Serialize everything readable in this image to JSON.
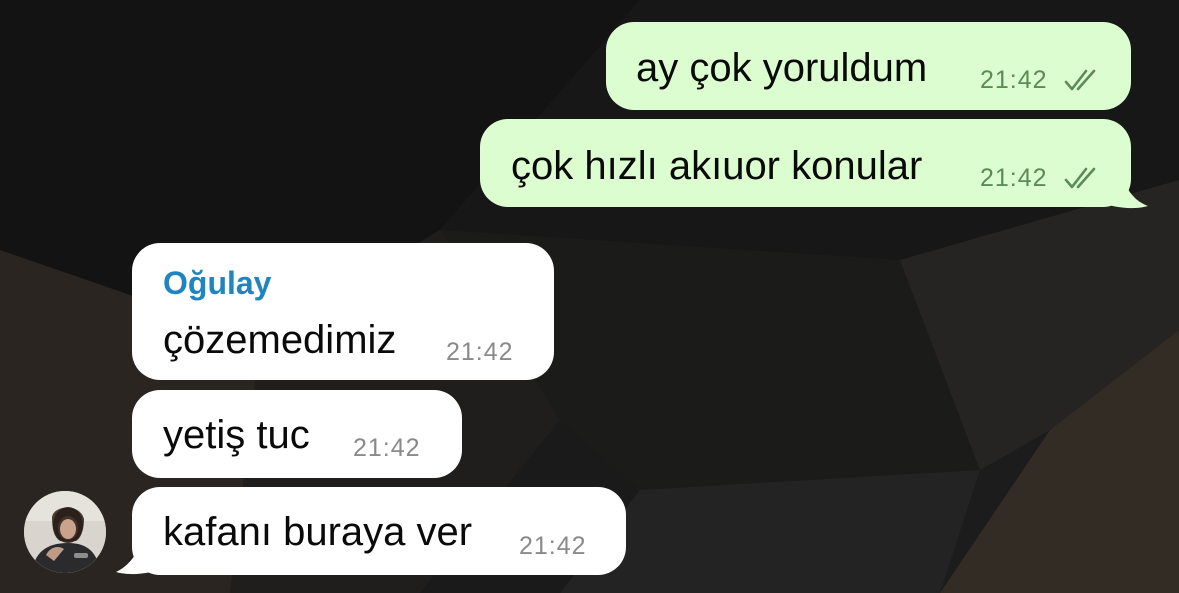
{
  "chat": {
    "messages": [
      {
        "id": "m1",
        "direction": "outgoing",
        "text": "ay çok yoruldum",
        "time": "21:42",
        "status": "read"
      },
      {
        "id": "m2",
        "direction": "outgoing",
        "text": "çok hızlı akıuor konular",
        "time": "21:42",
        "status": "read"
      },
      {
        "id": "m3",
        "direction": "incoming",
        "sender": "Oğulay",
        "text": "çözemedimiz",
        "time": "21:42"
      },
      {
        "id": "m4",
        "direction": "incoming",
        "text": "yetiş tuc",
        "time": "21:42"
      },
      {
        "id": "m5",
        "direction": "incoming",
        "text": "kafanı buraya ver",
        "time": "21:42"
      }
    ]
  },
  "colors": {
    "outgoing_bubble": "#dbfdcf",
    "incoming_bubble": "#ffffff",
    "sender_name": "#1f84bf",
    "read_check": "#5d8a55"
  },
  "icons": {
    "read_status": "double-check-icon",
    "avatar": "user-avatar"
  }
}
